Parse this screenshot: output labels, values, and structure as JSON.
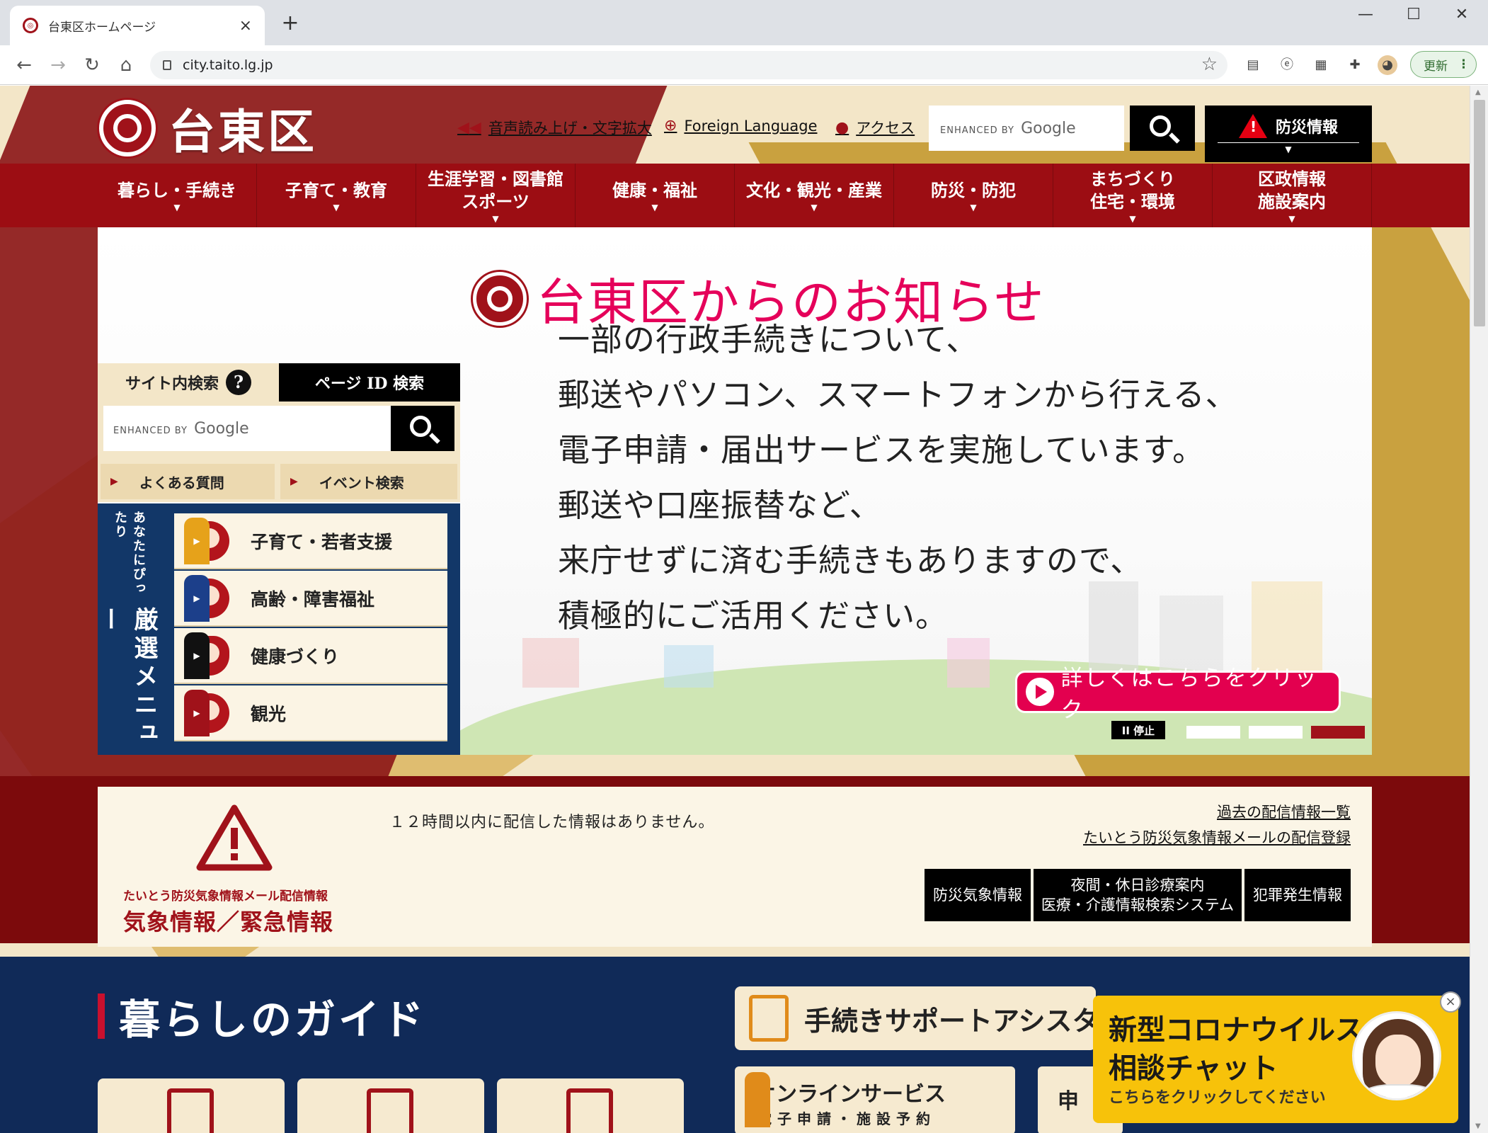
{
  "browser": {
    "tab_title": "台東区ホームページ",
    "url": "city.taito.lg.jp",
    "update_label": "更新"
  },
  "header": {
    "site_name": "台東区",
    "links": [
      {
        "icon": "speaker-icon",
        "label": "音声読み上げ・文字拡大"
      },
      {
        "icon": "globe-icon",
        "label": "Foreign Language"
      },
      {
        "icon": "map-pin-icon",
        "label": "アクセス"
      }
    ],
    "search_enhanced": "ENHANCED BY",
    "search_google": "Google",
    "disaster_label": "防災情報"
  },
  "nav": [
    {
      "l1": "暮らし・手続き",
      "l2": ""
    },
    {
      "l1": "子育て・教育",
      "l2": ""
    },
    {
      "l1": "生涯学習・図書館",
      "l2": "スポーツ"
    },
    {
      "l1": "健康・福祉",
      "l2": ""
    },
    {
      "l1": "文化・観光・産業",
      "l2": ""
    },
    {
      "l1": "防災・防犯",
      "l2": ""
    },
    {
      "l1": "まちづくり",
      "l2": "住宅・環境"
    },
    {
      "l1": "区政情報",
      "l2": "施設案内"
    }
  ],
  "hero": {
    "title": "台東区からのお知らせ",
    "lines": [
      "一部の行政手続きについて、",
      "郵送やパソコン、スマートフォンから行える、",
      "電子申請・届出サービスを実施しています。",
      "郵送や口座振替など、",
      "来庁せずに済む手続きもありますので、",
      "積極的にご活用ください。"
    ],
    "cta": "詳しくはこちらをクリック",
    "stop": "II 停止",
    "slides_total": 3,
    "slide_active": 3
  },
  "left_panel": {
    "tab_site_search": "サイト内検索",
    "tab_help": "?",
    "tab_page_id": "ページ ID 検索",
    "search_enhanced": "ENHANCED BY",
    "search_google": "Google",
    "quick_faq": "よくある質問",
    "quick_event": "イベント検索",
    "menu_small": "あなたにぴったり",
    "menu_big": "厳選メニュー",
    "menu_items": [
      {
        "label": "子育て・若者支援",
        "accent": "#e6a21a"
      },
      {
        "label": "高齢・障害福祉",
        "accent": "#1c3f8a"
      },
      {
        "label": "健康づくり",
        "accent": "#111111"
      },
      {
        "label": "観光",
        "accent": "#a0121a"
      }
    ]
  },
  "alert": {
    "sub": "たいとう防災気象情報メール配信情報",
    "title": "気象情報／緊急情報",
    "message": "１２時間以内に配信した情報はありません。",
    "link_past": "過去の配信情報一覧",
    "link_register": "たいとう防災気象情報メールの配信登録",
    "buttons": [
      {
        "l1": "防災気象情報",
        "l2": ""
      },
      {
        "l1": "夜間・休日診療案内",
        "l2": "医療・介護情報検索システム"
      },
      {
        "l1": "犯罪発生情報",
        "l2": ""
      }
    ]
  },
  "guide": {
    "title": "暮らしのガイド",
    "support": "手続きサポートアシスタント",
    "online_1": "オンラインサービス",
    "online_2": "電子申請・施設予約",
    "shinsei": "申"
  },
  "chat": {
    "title_1": "新型コロナウイルス",
    "title_2": "相談チャット",
    "sub": "こちらをクリックしてください",
    "close": "×"
  },
  "colors": {
    "brand_red": "#9c0d13",
    "accent_pink": "#e3004f",
    "navy": "#102a58",
    "gold": "#c9a13f"
  }
}
